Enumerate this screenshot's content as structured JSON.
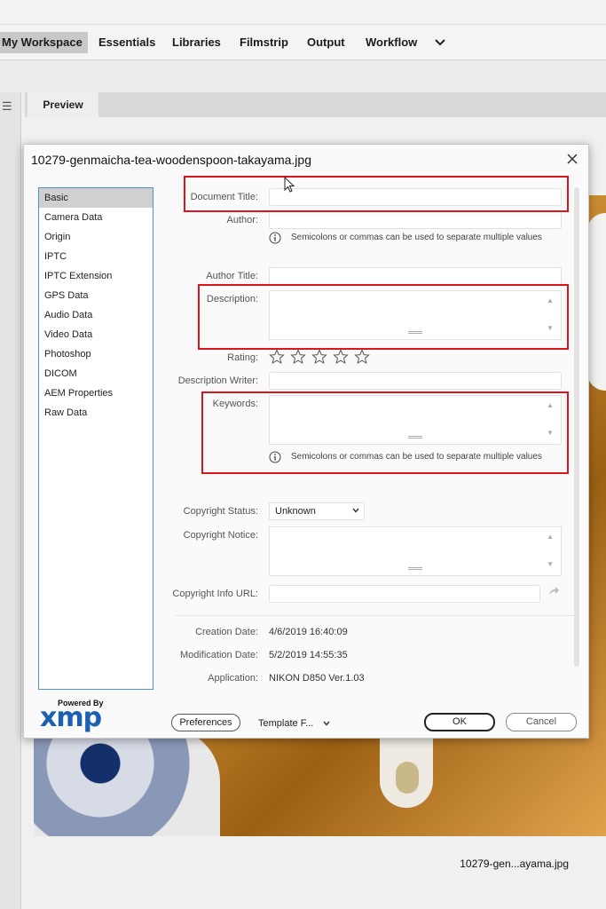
{
  "workspace_tabs": [
    "My Workspace",
    "Essentials",
    "Libraries",
    "Filmstrip",
    "Output",
    "Workflow"
  ],
  "preview_tab": "Preview",
  "preview_caption": "10279-gen...ayama.jpg",
  "dialog": {
    "title": "10279-genmaicha-tea-woodenspoon-takayama.jpg",
    "categories": [
      "Basic",
      "Camera Data",
      "Origin",
      "IPTC",
      "IPTC Extension",
      "GPS Data",
      "Audio Data",
      "Video Data",
      "Photoshop",
      "DICOM",
      "AEM Properties",
      "Raw Data"
    ],
    "selected_category": "Basic",
    "labels": {
      "document_title": "Document Title:",
      "author": "Author:",
      "author_title": "Author Title:",
      "description": "Description:",
      "rating": "Rating:",
      "description_writer": "Description Writer:",
      "keywords": "Keywords:",
      "copyright_status": "Copyright Status:",
      "copyright_notice": "Copyright Notice:",
      "copyright_info_url": "Copyright Info URL:",
      "creation_date": "Creation Date:",
      "modification_date": "Modification Date:",
      "application": "Application:"
    },
    "hint": "Semicolons or commas can be used to separate multiple values",
    "rating_value": 0,
    "rating_max": 5,
    "copyright_status_value": "Unknown",
    "creation_date": "4/6/2019 16:40:09",
    "modification_date": "5/2/2019 14:55:35",
    "application": "NIKON D850 Ver.1.03",
    "powered_by": "Powered By",
    "logo_text": "xmp",
    "buttons": {
      "preferences": "Preferences",
      "template": "Template F...",
      "ok": "OK",
      "cancel": "Cancel"
    }
  },
  "colors": {
    "highlight_box": "#d9141c",
    "category_border": "#4a90d9",
    "xmp_blue": "#1d5fb0"
  }
}
